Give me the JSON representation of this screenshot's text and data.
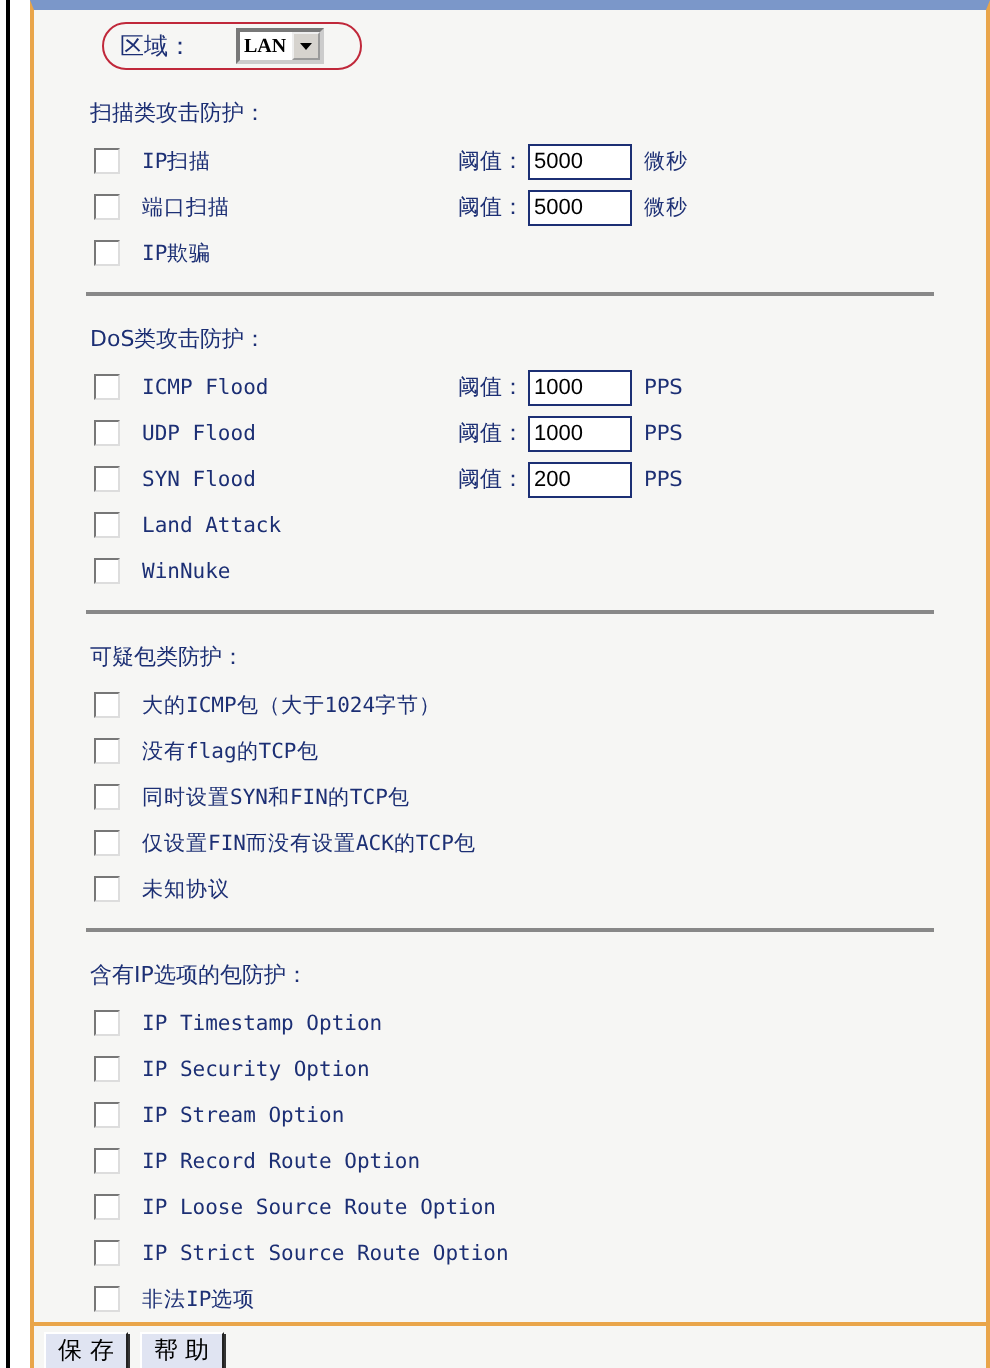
{
  "region": {
    "label": "区域：",
    "value": "LAN"
  },
  "sections": [
    {
      "title": "扫描类攻击防护：",
      "items": [
        {
          "label": "IP扫描",
          "checked": false,
          "threshold": {
            "label": "阈值：",
            "value": "5000",
            "unit": "微秒"
          }
        },
        {
          "label": "端口扫描",
          "checked": false,
          "threshold": {
            "label": "阈值：",
            "value": "5000",
            "unit": "微秒"
          }
        },
        {
          "label": "IP欺骗",
          "checked": false
        }
      ]
    },
    {
      "title": "DoS类攻击防护：",
      "items": [
        {
          "label": "ICMP Flood",
          "checked": false,
          "threshold": {
            "label": "阈值：",
            "value": "1000",
            "unit": "PPS"
          }
        },
        {
          "label": "UDP Flood",
          "checked": false,
          "threshold": {
            "label": "阈值：",
            "value": "1000",
            "unit": "PPS"
          }
        },
        {
          "label": "SYN Flood",
          "checked": false,
          "threshold": {
            "label": "阈值：",
            "value": "200",
            "unit": "PPS"
          }
        },
        {
          "label": "Land Attack",
          "checked": false
        },
        {
          "label": "WinNuke",
          "checked": false
        }
      ]
    },
    {
      "title": "可疑包类防护：",
      "items": [
        {
          "label": "大的ICMP包（大于1024字节）",
          "checked": false
        },
        {
          "label": "没有flag的TCP包",
          "checked": false
        },
        {
          "label": "同时设置SYN和FIN的TCP包",
          "checked": false
        },
        {
          "label": "仅设置FIN而没有设置ACK的TCP包",
          "checked": false
        },
        {
          "label": "未知协议",
          "checked": false
        }
      ]
    },
    {
      "title": "含有IP选项的包防护：",
      "items": [
        {
          "label": "IP Timestamp Option",
          "checked": false
        },
        {
          "label": "IP Security Option",
          "checked": false
        },
        {
          "label": "IP Stream Option",
          "checked": false
        },
        {
          "label": "IP Record Route Option",
          "checked": false
        },
        {
          "label": "IP Loose Source Route Option",
          "checked": false
        },
        {
          "label": "IP Strict Source Route Option",
          "checked": false
        },
        {
          "label": "非法IP选项",
          "checked": false
        }
      ]
    }
  ],
  "buttons": [
    "保 存",
    "帮 助"
  ]
}
